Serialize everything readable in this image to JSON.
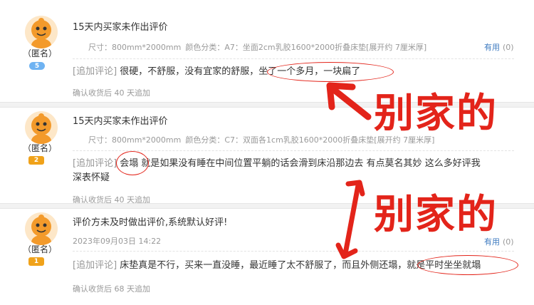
{
  "reviews": [
    {
      "title": "15天内买家未作出评价",
      "user": "（匿名）",
      "level": "5",
      "meta": [
        "尺寸：800mm*2000mm",
        "颜色分类：A7：坐面2cm乳胶1600*2000折叠床垫[展开约 7厘米厚]"
      ],
      "comment_tag": "[追加评论]",
      "comment_text": "很硬，不舒服，没有宜家的舒服，坐了一个多月，一块扁了",
      "append_time": "确认收货后 40 天追加",
      "useful_label": "有用",
      "useful_count": "(0)"
    },
    {
      "title": "15天内买家未作出评价",
      "user": "（匿名）",
      "level": "2",
      "meta": [
        "尺寸：800mm*2000mm",
        "颜色分类：C7：双面各1cm乳胶1600*2000折叠床垫[展开约 7厘米厚]"
      ],
      "comment_tag": "[追加评论]",
      "comment_text_1": "会塌 就是如果没有睡在中间位置平躺的话会滑到床沿那边去 有点莫名其妙 这么多好评我",
      "comment_text_2": "深表怀疑",
      "append_time": "确认收货后 40 天追加",
      "useful_label": "有用",
      "useful_count": "(0)"
    },
    {
      "title": "评价方未及时做出评价,系统默认好评!",
      "user": "（匿名）",
      "level": "1",
      "date": "2023年09月03日 14:22",
      "comment_tag": "[追加评论]",
      "comment_text": "床垫真是不行，买来一直没睡，最近睡了太不舒服了，而且外侧还塌，就是平时坐坐就塌",
      "append_time": "确认收货后 68 天追加",
      "useful_label": "有用",
      "useful_count": "(0)"
    }
  ],
  "annotations": {
    "label_1": "别家的",
    "label_2": "别家的",
    "color": "#e3241a"
  }
}
